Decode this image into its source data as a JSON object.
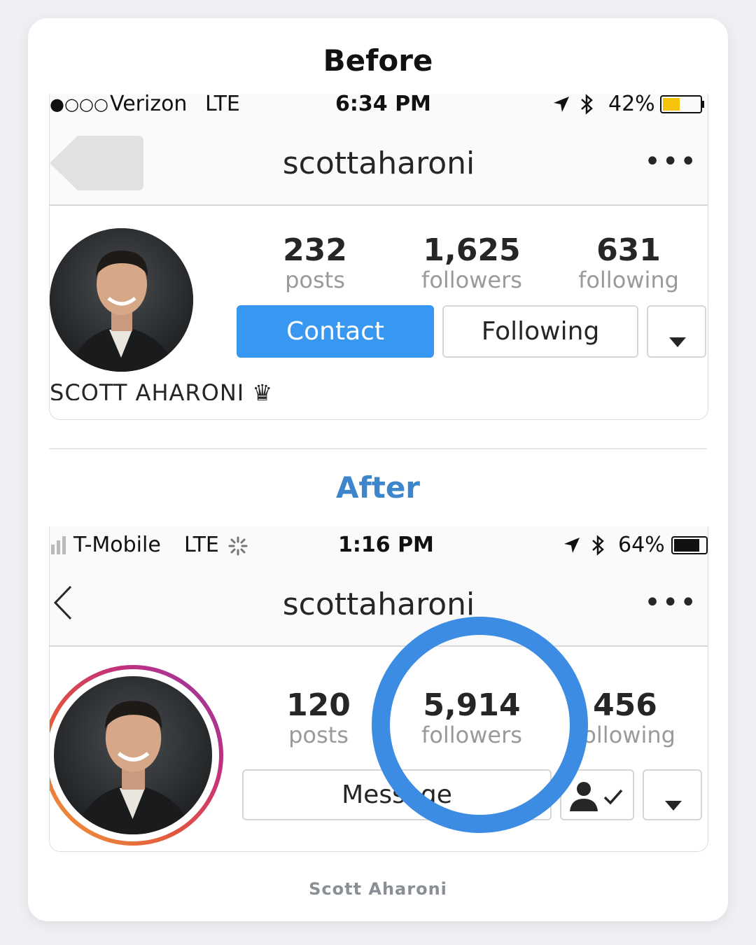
{
  "before": {
    "heading": "Before",
    "status": {
      "signal": "●○○○",
      "carrier": "Verizon",
      "network": "LTE",
      "time": "6:34 PM",
      "battery": "42%"
    },
    "username": "scottaharoni",
    "more": "•••",
    "stats": {
      "posts": "232",
      "posts_label": "posts",
      "followers": "1,625",
      "followers_label": "followers",
      "following": "631",
      "following_label": "following"
    },
    "contact_label": "Contact",
    "following_label": "Following",
    "bio_name": "SCOTT AHARONI ♛"
  },
  "after": {
    "heading": "After",
    "status": {
      "carrier": "T-Mobile",
      "network": "LTE",
      "time": "1:16 PM",
      "battery": "64%"
    },
    "username": "scottaharoni",
    "more": "•••",
    "stats": {
      "posts": "120",
      "posts_label": "posts",
      "followers": "5,914",
      "followers_label": "followers",
      "following": "456",
      "following_label": "following"
    },
    "message_label": "Message"
  },
  "caption": "Scott Aharoni",
  "colors": {
    "accent": "#3d86cc",
    "button_blue": "#3897f0",
    "highlight_circle": "#3c8ce4"
  }
}
